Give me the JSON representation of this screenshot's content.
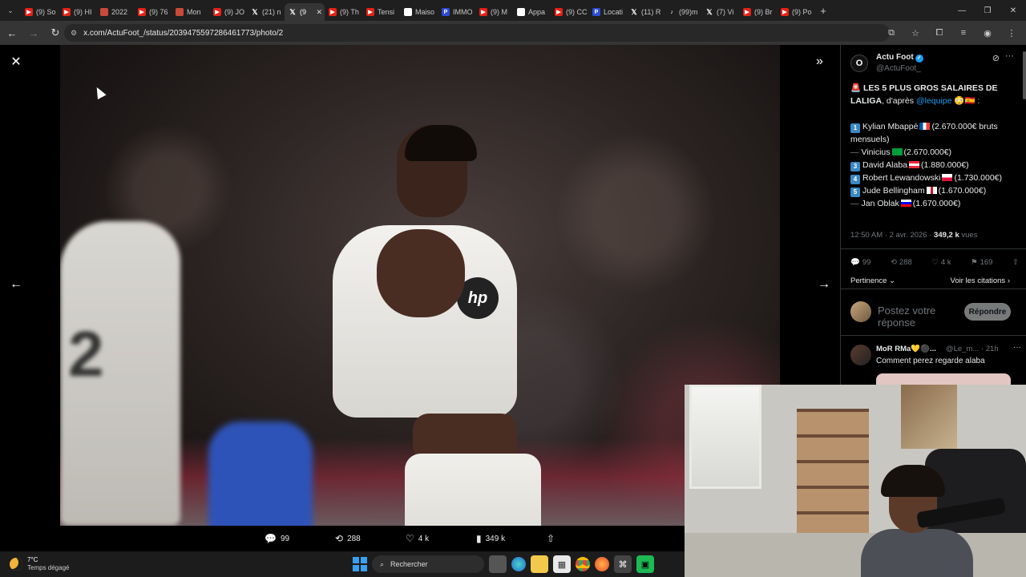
{
  "browser": {
    "tabs": [
      {
        "label": "(9) So",
        "icon": "youtube-icon"
      },
      {
        "label": "(9) HI",
        "icon": "youtube-icon"
      },
      {
        "label": "2022",
        "icon": "site-icon"
      },
      {
        "label": "(9) 76",
        "icon": "youtube-icon"
      },
      {
        "label": "Mon",
        "icon": "site-icon"
      },
      {
        "label": "(9) JO",
        "icon": "youtube-icon"
      },
      {
        "label": "(21) n",
        "icon": "x-icon"
      },
      {
        "label": "(9",
        "icon": "x-icon",
        "active": true
      },
      {
        "label": "(9) Th",
        "icon": "youtube-icon"
      },
      {
        "label": "Tensi",
        "icon": "youtube-icon"
      },
      {
        "label": "Maiso",
        "icon": "doc-icon"
      },
      {
        "label": "IMMO",
        "icon": "p-icon"
      },
      {
        "label": "(9) M",
        "icon": "youtube-icon"
      },
      {
        "label": "Appa",
        "icon": "doc-icon"
      },
      {
        "label": "(9) CC",
        "icon": "youtube-icon"
      },
      {
        "label": "Locati",
        "icon": "p-icon"
      },
      {
        "label": "(11) R",
        "icon": "x-icon"
      },
      {
        "label": "(99)m",
        "icon": "tiktok-icon"
      },
      {
        "label": "(7) Vi",
        "icon": "x-icon"
      },
      {
        "label": "(9) Br",
        "icon": "youtube-icon"
      },
      {
        "label": "(9) Po",
        "icon": "youtube-icon"
      }
    ],
    "url": "x.com/ActuFoot_/status/2039475597286461773/photo/2"
  },
  "viewer": {
    "stats": {
      "replies": "99",
      "reposts": "288",
      "likes": "4 k",
      "views": "349 k"
    }
  },
  "post": {
    "author_name": "Actu Foot",
    "author_handle": "@ActuFoot_",
    "avatar_text": "O",
    "headline_bold": "LES 5 PLUS GROS SALAIRES DE LALIGA",
    "headline_rest": ", d'après ",
    "mention": "@lequipe",
    "ranking": [
      {
        "rank": "1",
        "name": "Kylian Mbappé",
        "value": "(2.670.000€ bruts mensuels)"
      },
      {
        "rank": "—",
        "name": "Vinicius",
        "value": "(2.670.000€)"
      },
      {
        "rank": "3",
        "name": "David Alaba",
        "value": "(1.880.000€)"
      },
      {
        "rank": "4",
        "name": "Robert Lewandowski",
        "value": "(1.730.000€)"
      },
      {
        "rank": "5",
        "name": "Jude Bellingham",
        "value": "(1.670.000€)"
      },
      {
        "rank": "—",
        "name": "Jan Oblak",
        "value": "(1.670.000€)"
      }
    ],
    "time": "12:50 AM · 2 avr. 2026 · ",
    "views_count": "349,2 k",
    "views_label": " vues",
    "stats": {
      "replies": "99",
      "reposts": "288",
      "likes": "4 k",
      "bookmarks": "169"
    },
    "sort_label": "Pertinence",
    "quotes_label": "Voir les citations",
    "reply_placeholder": "Postez votre réponse",
    "reply_button": "Répondre"
  },
  "reply": {
    "name": "MoR RMa💛⚫...",
    "handle": "@Le_m... · 21h",
    "text": "Comment perez regarde alaba"
  },
  "taskbar": {
    "temperature": "7°C",
    "weather": "Temps dégagé",
    "search_label": "Rechercher"
  },
  "photo": {
    "jersey_logo": "hp",
    "jersey_number": "2"
  }
}
